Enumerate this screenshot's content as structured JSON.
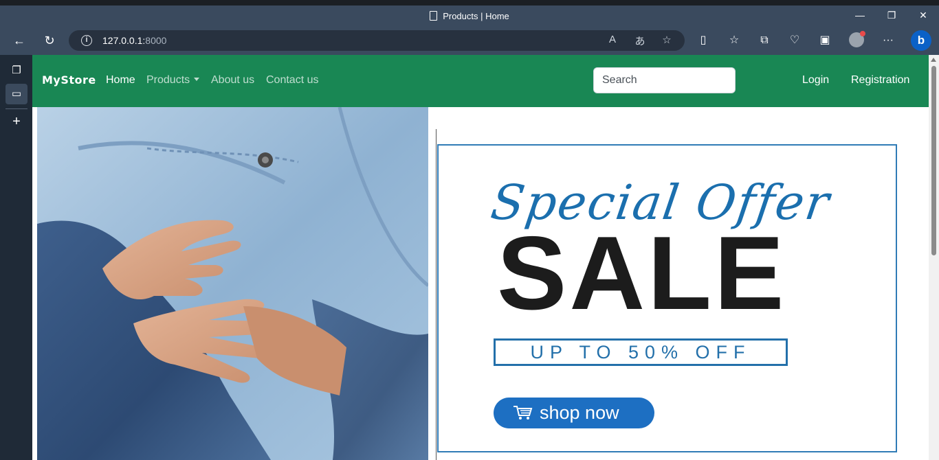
{
  "browser": {
    "title": "Products | Home",
    "url_host": "127.0.0.1:",
    "url_port": "8000"
  },
  "site": {
    "brand": "MyStore",
    "nav": {
      "home": "Home",
      "products": "Products",
      "about": "About us",
      "contact": "Contact us"
    },
    "search_placeholder": "Search",
    "login": "Login",
    "registration": "Registration"
  },
  "promo": {
    "special": "Special Offer",
    "sale": "SALE",
    "discount": "UP TO 50% OFF",
    "cta": "shop now"
  },
  "colors": {
    "navbar": "#198754",
    "promo_blue": "#1d6fc2"
  }
}
